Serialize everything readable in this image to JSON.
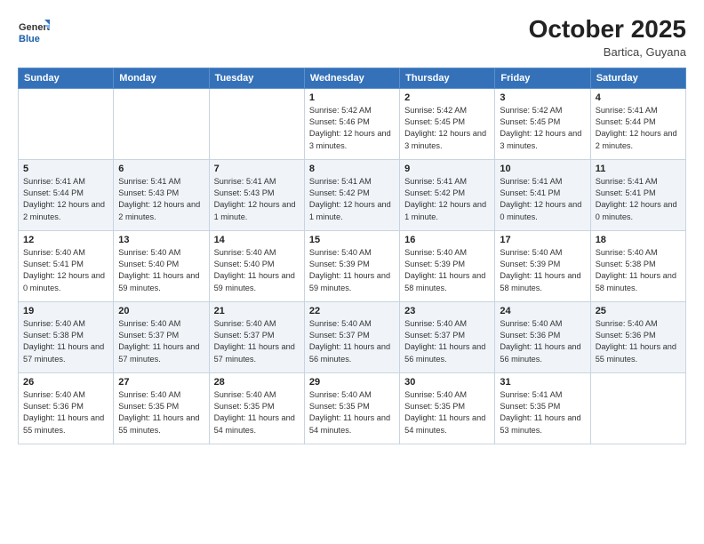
{
  "header": {
    "logo_general": "General",
    "logo_blue": "Blue",
    "month_title": "October 2025",
    "location": "Bartica, Guyana"
  },
  "weekdays": [
    "Sunday",
    "Monday",
    "Tuesday",
    "Wednesday",
    "Thursday",
    "Friday",
    "Saturday"
  ],
  "weeks": [
    [
      {
        "day": "",
        "sunrise": "",
        "sunset": "",
        "daylight": ""
      },
      {
        "day": "",
        "sunrise": "",
        "sunset": "",
        "daylight": ""
      },
      {
        "day": "",
        "sunrise": "",
        "sunset": "",
        "daylight": ""
      },
      {
        "day": "1",
        "sunrise": "Sunrise: 5:42 AM",
        "sunset": "Sunset: 5:46 PM",
        "daylight": "Daylight: 12 hours and 3 minutes."
      },
      {
        "day": "2",
        "sunrise": "Sunrise: 5:42 AM",
        "sunset": "Sunset: 5:45 PM",
        "daylight": "Daylight: 12 hours and 3 minutes."
      },
      {
        "day": "3",
        "sunrise": "Sunrise: 5:42 AM",
        "sunset": "Sunset: 5:45 PM",
        "daylight": "Daylight: 12 hours and 3 minutes."
      },
      {
        "day": "4",
        "sunrise": "Sunrise: 5:41 AM",
        "sunset": "Sunset: 5:44 PM",
        "daylight": "Daylight: 12 hours and 2 minutes."
      }
    ],
    [
      {
        "day": "5",
        "sunrise": "Sunrise: 5:41 AM",
        "sunset": "Sunset: 5:44 PM",
        "daylight": "Daylight: 12 hours and 2 minutes."
      },
      {
        "day": "6",
        "sunrise": "Sunrise: 5:41 AM",
        "sunset": "Sunset: 5:43 PM",
        "daylight": "Daylight: 12 hours and 2 minutes."
      },
      {
        "day": "7",
        "sunrise": "Sunrise: 5:41 AM",
        "sunset": "Sunset: 5:43 PM",
        "daylight": "Daylight: 12 hours and 1 minute."
      },
      {
        "day": "8",
        "sunrise": "Sunrise: 5:41 AM",
        "sunset": "Sunset: 5:42 PM",
        "daylight": "Daylight: 12 hours and 1 minute."
      },
      {
        "day": "9",
        "sunrise": "Sunrise: 5:41 AM",
        "sunset": "Sunset: 5:42 PM",
        "daylight": "Daylight: 12 hours and 1 minute."
      },
      {
        "day": "10",
        "sunrise": "Sunrise: 5:41 AM",
        "sunset": "Sunset: 5:41 PM",
        "daylight": "Daylight: 12 hours and 0 minutes."
      },
      {
        "day": "11",
        "sunrise": "Sunrise: 5:41 AM",
        "sunset": "Sunset: 5:41 PM",
        "daylight": "Daylight: 12 hours and 0 minutes."
      }
    ],
    [
      {
        "day": "12",
        "sunrise": "Sunrise: 5:40 AM",
        "sunset": "Sunset: 5:41 PM",
        "daylight": "Daylight: 12 hours and 0 minutes."
      },
      {
        "day": "13",
        "sunrise": "Sunrise: 5:40 AM",
        "sunset": "Sunset: 5:40 PM",
        "daylight": "Daylight: 11 hours and 59 minutes."
      },
      {
        "day": "14",
        "sunrise": "Sunrise: 5:40 AM",
        "sunset": "Sunset: 5:40 PM",
        "daylight": "Daylight: 11 hours and 59 minutes."
      },
      {
        "day": "15",
        "sunrise": "Sunrise: 5:40 AM",
        "sunset": "Sunset: 5:39 PM",
        "daylight": "Daylight: 11 hours and 59 minutes."
      },
      {
        "day": "16",
        "sunrise": "Sunrise: 5:40 AM",
        "sunset": "Sunset: 5:39 PM",
        "daylight": "Daylight: 11 hours and 58 minutes."
      },
      {
        "day": "17",
        "sunrise": "Sunrise: 5:40 AM",
        "sunset": "Sunset: 5:39 PM",
        "daylight": "Daylight: 11 hours and 58 minutes."
      },
      {
        "day": "18",
        "sunrise": "Sunrise: 5:40 AM",
        "sunset": "Sunset: 5:38 PM",
        "daylight": "Daylight: 11 hours and 58 minutes."
      }
    ],
    [
      {
        "day": "19",
        "sunrise": "Sunrise: 5:40 AM",
        "sunset": "Sunset: 5:38 PM",
        "daylight": "Daylight: 11 hours and 57 minutes."
      },
      {
        "day": "20",
        "sunrise": "Sunrise: 5:40 AM",
        "sunset": "Sunset: 5:37 PM",
        "daylight": "Daylight: 11 hours and 57 minutes."
      },
      {
        "day": "21",
        "sunrise": "Sunrise: 5:40 AM",
        "sunset": "Sunset: 5:37 PM",
        "daylight": "Daylight: 11 hours and 57 minutes."
      },
      {
        "day": "22",
        "sunrise": "Sunrise: 5:40 AM",
        "sunset": "Sunset: 5:37 PM",
        "daylight": "Daylight: 11 hours and 56 minutes."
      },
      {
        "day": "23",
        "sunrise": "Sunrise: 5:40 AM",
        "sunset": "Sunset: 5:37 PM",
        "daylight": "Daylight: 11 hours and 56 minutes."
      },
      {
        "day": "24",
        "sunrise": "Sunrise: 5:40 AM",
        "sunset": "Sunset: 5:36 PM",
        "daylight": "Daylight: 11 hours and 56 minutes."
      },
      {
        "day": "25",
        "sunrise": "Sunrise: 5:40 AM",
        "sunset": "Sunset: 5:36 PM",
        "daylight": "Daylight: 11 hours and 55 minutes."
      }
    ],
    [
      {
        "day": "26",
        "sunrise": "Sunrise: 5:40 AM",
        "sunset": "Sunset: 5:36 PM",
        "daylight": "Daylight: 11 hours and 55 minutes."
      },
      {
        "day": "27",
        "sunrise": "Sunrise: 5:40 AM",
        "sunset": "Sunset: 5:35 PM",
        "daylight": "Daylight: 11 hours and 55 minutes."
      },
      {
        "day": "28",
        "sunrise": "Sunrise: 5:40 AM",
        "sunset": "Sunset: 5:35 PM",
        "daylight": "Daylight: 11 hours and 54 minutes."
      },
      {
        "day": "29",
        "sunrise": "Sunrise: 5:40 AM",
        "sunset": "Sunset: 5:35 PM",
        "daylight": "Daylight: 11 hours and 54 minutes."
      },
      {
        "day": "30",
        "sunrise": "Sunrise: 5:40 AM",
        "sunset": "Sunset: 5:35 PM",
        "daylight": "Daylight: 11 hours and 54 minutes."
      },
      {
        "day": "31",
        "sunrise": "Sunrise: 5:41 AM",
        "sunset": "Sunset: 5:35 PM",
        "daylight": "Daylight: 11 hours and 53 minutes."
      },
      {
        "day": "",
        "sunrise": "",
        "sunset": "",
        "daylight": ""
      }
    ]
  ]
}
